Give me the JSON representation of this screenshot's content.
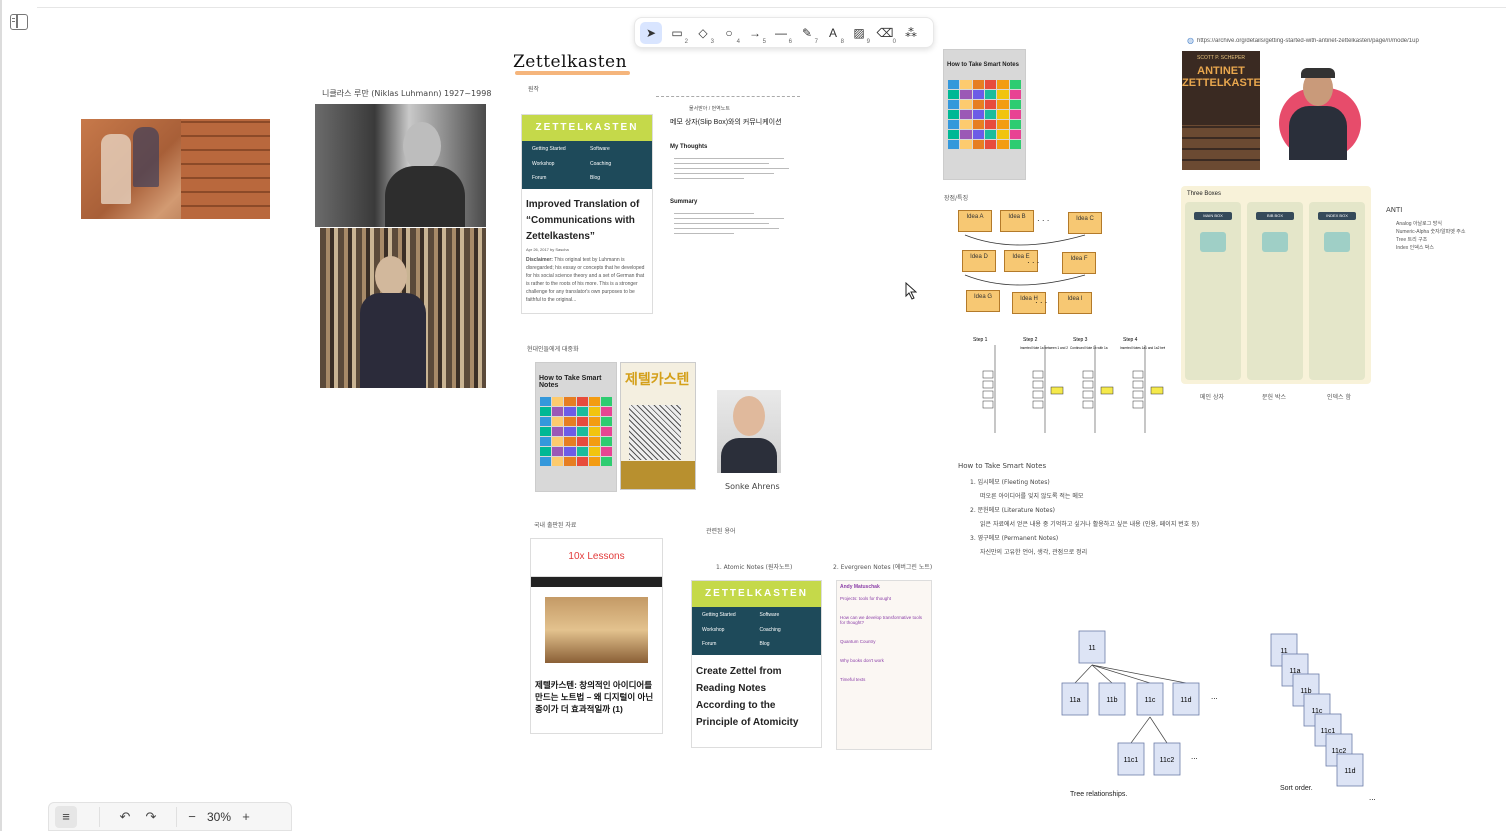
{
  "toolbar": {
    "tools": [
      {
        "name": "select-tool",
        "glyph": "➤",
        "key": ""
      },
      {
        "name": "rectangle-tool",
        "glyph": "▭",
        "key": "2"
      },
      {
        "name": "diamond-tool",
        "glyph": "◇",
        "key": "3"
      },
      {
        "name": "ellipse-tool",
        "glyph": "○",
        "key": "4"
      },
      {
        "name": "arrow-tool",
        "glyph": "→",
        "key": "5"
      },
      {
        "name": "line-tool",
        "glyph": "—",
        "key": "6"
      },
      {
        "name": "pencil-tool",
        "glyph": "✎",
        "key": "7"
      },
      {
        "name": "text-tool",
        "glyph": "A",
        "key": "8"
      },
      {
        "name": "image-tool",
        "glyph": "▨",
        "key": "9"
      },
      {
        "name": "eraser-tool",
        "glyph": "⌫",
        "key": "0"
      },
      {
        "name": "more-tools",
        "glyph": "⁂",
        "key": ""
      }
    ]
  },
  "canvas": {
    "title": "Zettelkasten",
    "luhmann_caption": "니클라스 루만 (Niklas Luhmann) 1927~1998",
    "label_origin": "원작",
    "label_modern": "현대인들에게 대중화",
    "label_korean_ref": "국내 출판된 자료",
    "label_concepts": "관련된 용어",
    "label_atomic": "1. Atomic Notes (원자노트)",
    "label_evergreen": "2. Evergreen Notes (에버그린 노트)",
    "label_method": "장점/특징",
    "sonke": "Sonke Ahrens",
    "url_archive": "https://archive.org/details/getting-started-with-antinet-zettelkasten/page/n/mode/1up",
    "zk_article": {
      "header": "ZETTELKASTEN",
      "nav": [
        "Getting Started",
        "Software",
        "Workshop",
        "Coaching",
        "Forum",
        "Blog"
      ],
      "title": "Improved Translation of “Communications with Zettelkastens”",
      "date": "Apr 26, 2017 by Sascha",
      "body_lead": "Disclaimer:",
      "body": "This original text by Luhmann is disregarded; his essay or concepts that he developed for his social science theory and a set of German that is rather to the roots of his more. This is a stronger challenge for any translator's own purposes to be faithful to the original..."
    },
    "note_card": {
      "breadcrumb": "물서받아 / 번역노트",
      "title": "메모 상자(Slip Box)와의 커뮤니케이션",
      "h_thoughts": "My Thoughts",
      "h_summary": "Summary"
    },
    "lessons": {
      "title": "10x Lessons",
      "article": "제텔카스텐: 창의적인 아이디어를 만드는 노트법 – 왜 디지털이 아닌 종이가 더 효과적일까 (1)"
    },
    "zk_card2": {
      "header": "ZETTELKASTEN",
      "nav": [
        "Getting Started",
        "Software",
        "Workshop",
        "Coaching",
        "Forum",
        "Blog"
      ],
      "title": "Create Zettel from Reading Notes According to the Principle of Atomicity"
    },
    "evergreen": {
      "author": "Andy Matuschak",
      "items": [
        "Projects: tools for thought",
        "How can we develop transformative tools for thought?",
        "Quantum Country",
        "Why books don't work",
        "Timeful texts"
      ]
    },
    "book1": {
      "title": "How to Take Smart Notes"
    },
    "book_kr": {
      "title": "제텔카스텐"
    },
    "antinet": {
      "author": "SCOTT P. SCHEPER",
      "title": "ANTINET ZETTELKASTEN"
    },
    "three_boxes": {
      "title": "Three Boxes",
      "boxes": [
        "MAIN BOX",
        "BIB BOX",
        "INDEX BOX"
      ],
      "labels": [
        "메인 상자",
        "문헌 박스",
        "인덱스 함"
      ]
    },
    "anti": {
      "title": "ANTI",
      "lines": [
        "Analog 아날로그 방식",
        "Numeric-Alpha 숫자/알파벳 주소",
        "Tree 트리 구조",
        "Index 인덱스 박스"
      ]
    },
    "smart_notes": {
      "heading": "How to Take Smart Notes",
      "items": [
        "1. 임시메모 (Fleeting Notes)",
        "떠오른 아이디어를 잊지 않도록 적는 메모",
        "2. 문헌메모 (Literature Notes)",
        "읽은 자료에서 얻은 내용 중 기억하고 싶거나 활용하고 싶은 내용 (인용, 페이지 번호 등)",
        "3. 영구메모 (Permanent Notes)",
        "자신만의 고유한 언어, 생각, 관점으로 정리"
      ]
    },
    "tree": {
      "caption": "Tree relationships.",
      "nodes": [
        "11",
        "11a",
        "11b",
        "11c",
        "11d",
        "11c1",
        "11c2"
      ],
      "ellipsis": "..."
    },
    "sort": {
      "caption": "Sort order.",
      "nodes": [
        "11",
        "11a",
        "11b",
        "11c",
        "11c1",
        "11c2",
        "11d"
      ],
      "ellipsis": "..."
    },
    "steps": [
      "Step 1",
      "Step 2",
      "Step 3",
      "Step 4"
    ],
    "step_notes": [
      "Inserted Note 1a between 1 and 2",
      "Continued Note 1b with 1a",
      "Inserted Notes 1a1 and 1a2 between 1a and 1b"
    ],
    "method_notes": [
      "Idea A",
      "Idea B",
      "Idea C",
      "Idea D",
      "Idea E",
      "Idea F",
      "Idea G",
      "Idea H",
      "Idea I"
    ]
  },
  "bottom": {
    "zoom": "30%",
    "menu_icon": "menu-icon",
    "undo_icon": "undo-icon",
    "redo_icon": "redo-icon"
  },
  "colors": {
    "zk_green": "#c5d94a",
    "zk_navy": "#1e4a5a",
    "toolbar_active": "#d9e5ff",
    "sticky": "#f7c873",
    "tree_node": "#dde4f5"
  }
}
